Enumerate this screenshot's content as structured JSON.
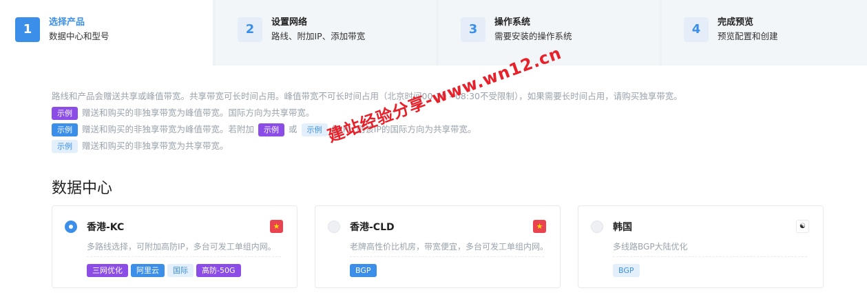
{
  "steps": [
    {
      "num": "1",
      "title": "选择产品",
      "sub": "数据中心和型号"
    },
    {
      "num": "2",
      "title": "设置网络",
      "sub": "路线、附加IP、添加带宽"
    },
    {
      "num": "3",
      "title": "操作系统",
      "sub": "需要安装的操作系统"
    },
    {
      "num": "4",
      "title": "完成预览",
      "sub": "预览配置和创建"
    }
  ],
  "notice": {
    "line1": "路线和产品会赠送共享或峰值带宽。共享带宽可长时间占用。峰值带宽不可长时间占用（北京时间00:30 - 08:30不受限制），如果需要长时间占用，请购买独享带宽。",
    "example_label": "示例",
    "line2": "赠送和购买的非独享带宽为峰值带宽。国际方向为共享带宽。",
    "line3_a": "赠送和购买的非独享带宽为峰值带宽。若附加",
    "line3_or": "或",
    "line3_b": "的IP，则该IP的国际方向为共享带宽。",
    "line4": "赠送和购买的非独享带宽为共享带宽。"
  },
  "watermark": "建站经验分享-www.wn12.cn",
  "section_title": "数据中心",
  "datacenters": [
    {
      "name": "香港-KC",
      "desc": "多路线选择，可附加高防IP，多台可发工单组内网。",
      "flag": "★",
      "tags": [
        {
          "label": "三网优化",
          "style": "purple"
        },
        {
          "label": "阿里云",
          "style": "blue"
        },
        {
          "label": "国际",
          "style": "light"
        },
        {
          "label": "高防-50G",
          "style": "purple"
        }
      ]
    },
    {
      "name": "香港-CLD",
      "desc": "老牌高性价比机房，带宽便宜，多台可发工单组内网。",
      "flag": "★",
      "tags": [
        {
          "label": "BGP",
          "style": "blue"
        }
      ]
    },
    {
      "name": "韩国",
      "desc": "多线路BGP大陆优化",
      "flag": "☯",
      "tags": [
        {
          "label": "BGP",
          "style": "light"
        }
      ]
    }
  ]
}
